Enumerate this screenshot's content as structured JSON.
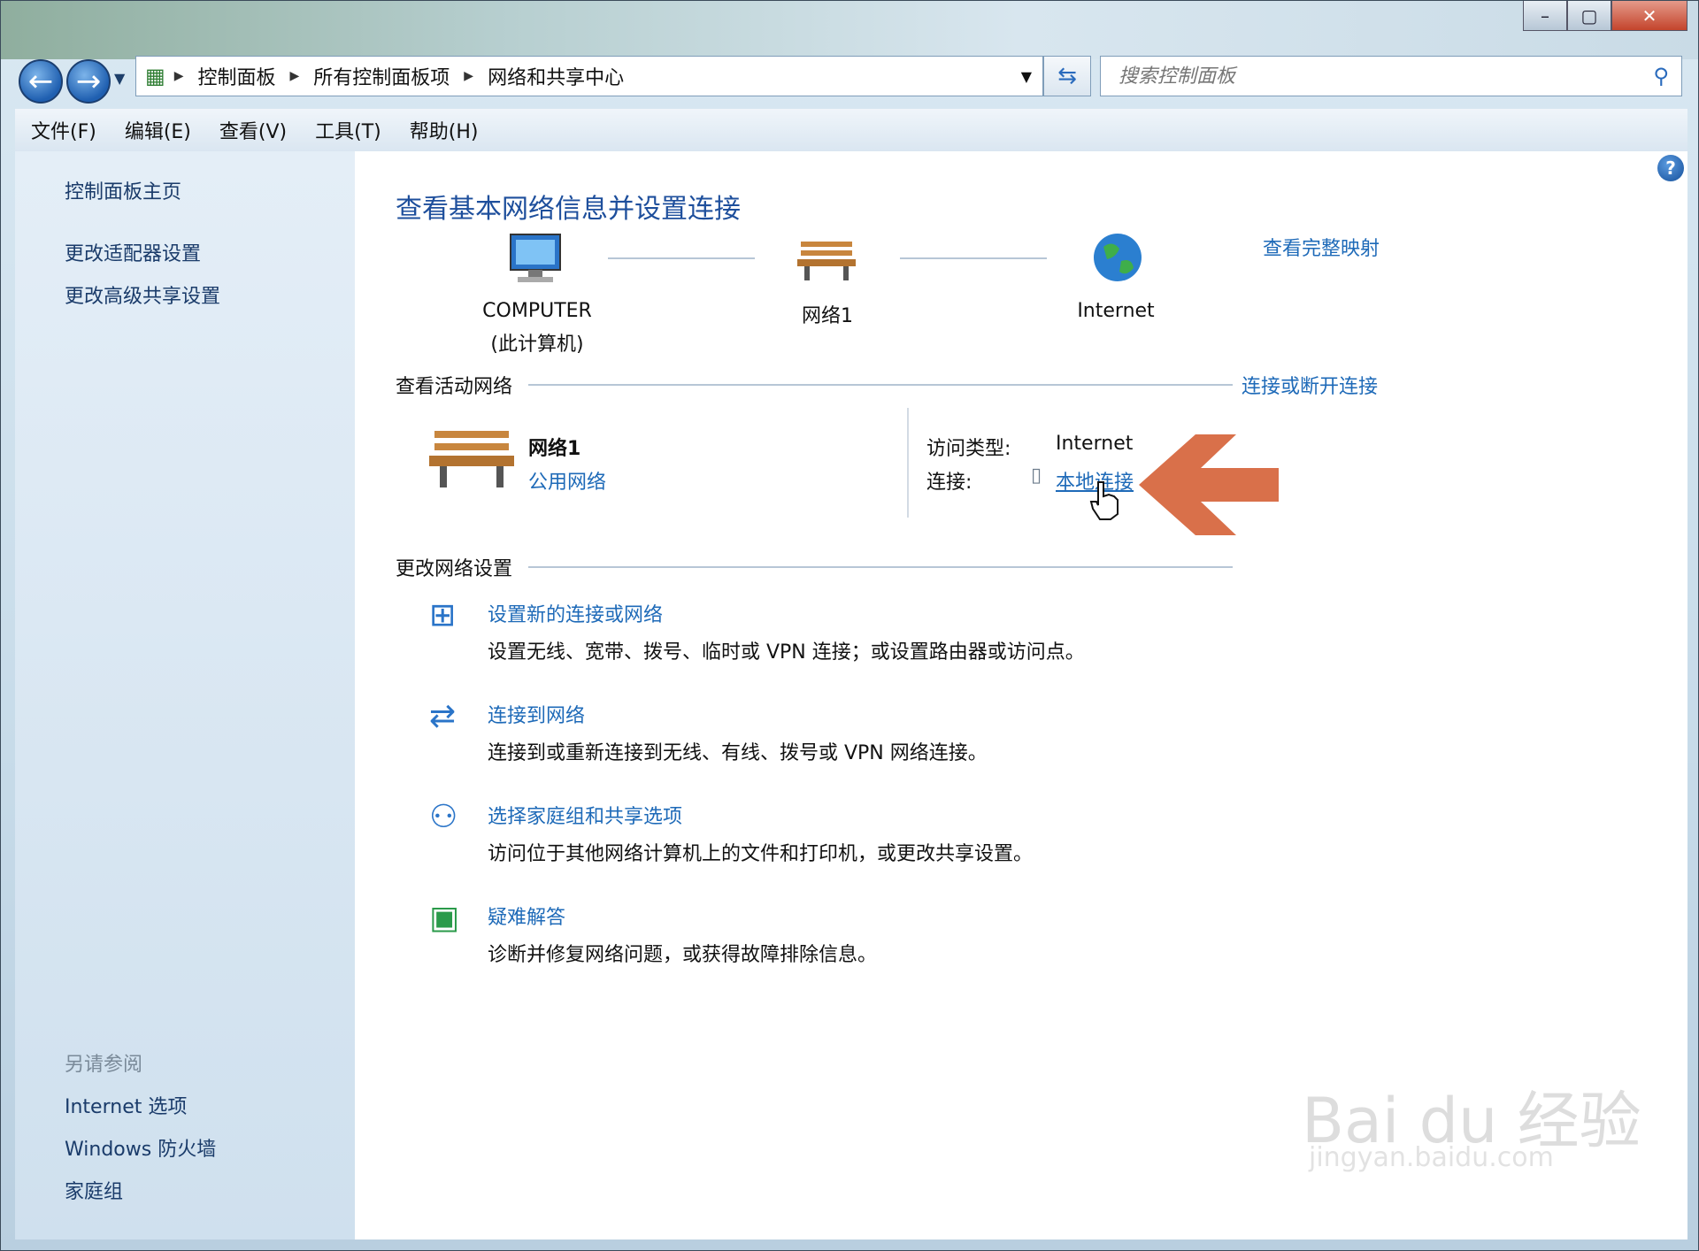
{
  "titlebar": {},
  "address": {
    "crumbs": [
      "控制面板",
      "所有控制面板项",
      "网络和共享中心"
    ]
  },
  "search": {
    "placeholder": "搜索控制面板"
  },
  "menu": [
    "文件(F)",
    "编辑(E)",
    "查看(V)",
    "工具(T)",
    "帮助(H)"
  ],
  "sidebar": {
    "items": [
      "控制面板主页",
      "更改适配器设置",
      "更改高级共享设置"
    ],
    "see_also_header": "另请参阅",
    "see_also": [
      "Internet 选项",
      "Windows 防火墙",
      "家庭组"
    ]
  },
  "main": {
    "title": "查看基本网络信息并设置连接",
    "full_map_link": "查看完整映射",
    "nodes": [
      {
        "label": "COMPUTER",
        "sublabel": "(此计算机)"
      },
      {
        "label": "网络1"
      },
      {
        "label": "Internet"
      }
    ],
    "active_section": "查看活动网络",
    "connect_link": "连接或断开连接",
    "network_name": "网络1",
    "network_type": "公用网络",
    "access_type_label": "访问类型:",
    "access_type_value": "Internet",
    "connection_label": "连接:",
    "connection_value": "本地连接",
    "change_section": "更改网络设置",
    "tasks": [
      {
        "title": "设置新的连接或网络",
        "desc": "设置无线、宽带、拨号、临时或 VPN 连接；或设置路由器或访问点。"
      },
      {
        "title": "连接到网络",
        "desc": "连接到或重新连接到无线、有线、拨号或 VPN 网络连接。"
      },
      {
        "title": "选择家庭组和共享选项",
        "desc": "访问位于其他网络计算机上的文件和打印机，或更改共享设置。"
      },
      {
        "title": "疑难解答",
        "desc": "诊断并修复网络问题，或获得故障排除信息。"
      }
    ]
  },
  "watermark": {
    "brand": "Bai du 经验",
    "url": "jingyan.baidu.com"
  },
  "colors": {
    "link": "#1e6ab8",
    "title": "#1e4f9c",
    "arrow": "#d9704a"
  }
}
